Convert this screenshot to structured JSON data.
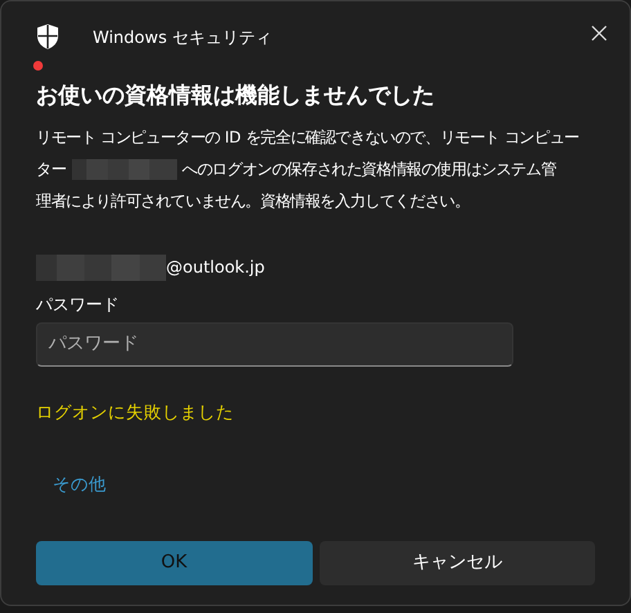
{
  "window": {
    "title": "Windows セキュリティ"
  },
  "heading": "お使いの資格情報は機能しませんでした",
  "message": {
    "line_1": "リモート コンピューターの ID を完全に確認できないので、リモート コンピュー",
    "line_2_before": "ター",
    "line_2_after": "へのログオンの保存された資格情報の使用はシステム管",
    "line_3": "理者により許可されていません。資格情報を入力してください。"
  },
  "account": {
    "suffix": "@outlook.jp"
  },
  "password": {
    "label": "パスワード",
    "placeholder": "パスワード"
  },
  "error": "ログオンに失敗しました",
  "more_link": "その他",
  "buttons": [
    {
      "label": "OK",
      "kind": "primary"
    },
    {
      "label": "キャンセル",
      "kind": "secondary"
    }
  ]
}
